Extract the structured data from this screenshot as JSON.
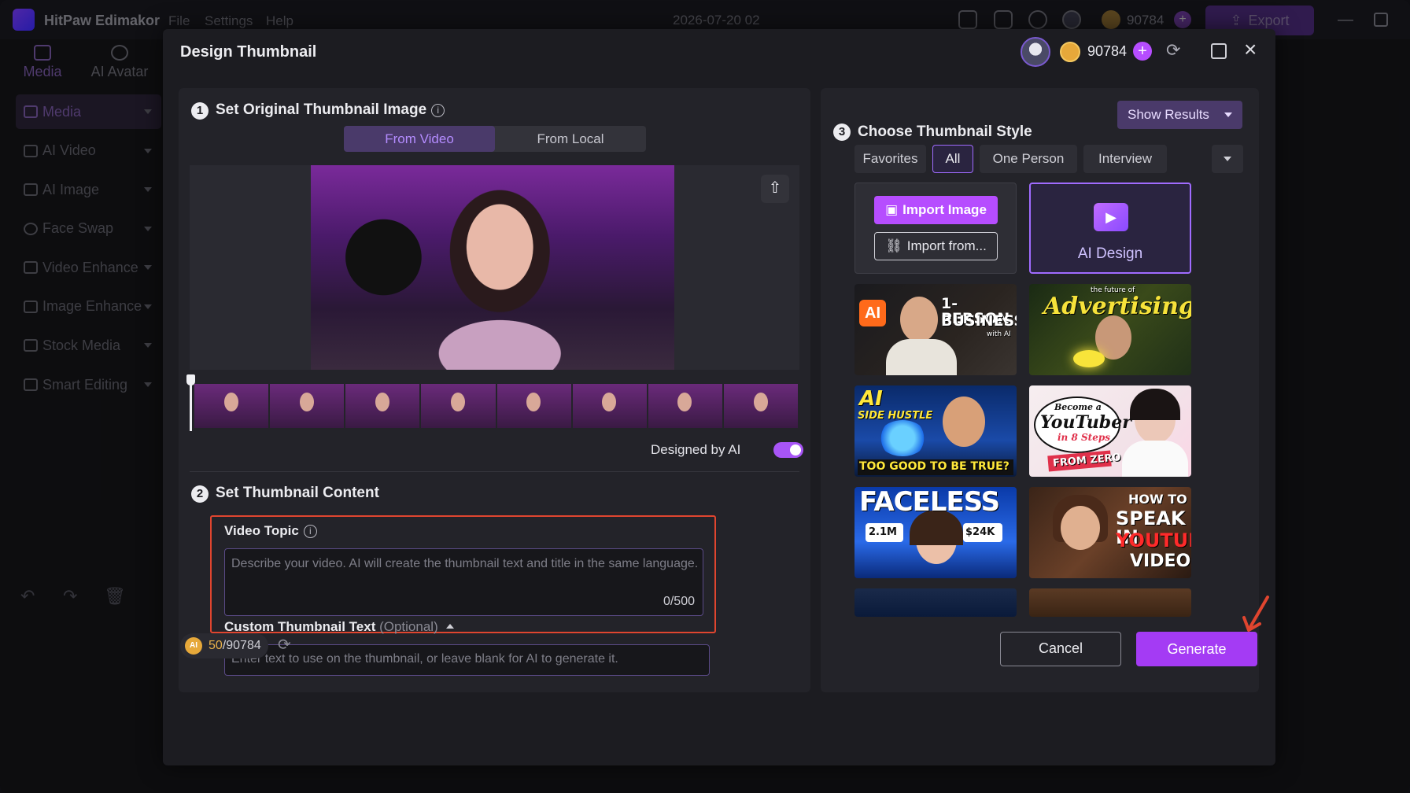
{
  "app": {
    "name": "HitPaw Edimakor",
    "menus": [
      "File",
      "Settings",
      "Help"
    ],
    "doc_title": "2026-07-20 02",
    "coins": "90784",
    "export_label": "Export"
  },
  "left_tabs": [
    {
      "label": "Media",
      "icon": "media-icon"
    },
    {
      "label": "AI Avatar",
      "icon": "avatar-icon"
    }
  ],
  "sidebar": {
    "items": [
      {
        "label": "Media"
      },
      {
        "label": "AI Video"
      },
      {
        "label": "AI Image"
      },
      {
        "label": "Face Swap"
      },
      {
        "label": "Video Enhance"
      },
      {
        "label": "Image Enhance"
      },
      {
        "label": "Stock Media"
      },
      {
        "label": "Smart Editing"
      }
    ]
  },
  "dialog": {
    "title": "Design Thumbnail",
    "coins": "90784",
    "step1": {
      "num": "1",
      "title": "Set Original Thumbnail Image",
      "tabs": [
        "From Video",
        "From Local"
      ],
      "designed_by_ai_label": "Designed by AI",
      "designed_by_ai_on": true
    },
    "step2": {
      "num": "2",
      "title": "Set Thumbnail Content",
      "video_topic_label": "Video Topic",
      "video_topic_placeholder": "Describe your video. AI will create the thumbnail text and title in the same language.",
      "video_topic_count": "0/500",
      "custom_text_label": "Custom Thumbnail Text",
      "custom_text_optional": "(Optional)",
      "custom_text_placeholder": "Enter text to use on the thumbnail, or leave blank for AI to generate it."
    },
    "step3": {
      "num": "3",
      "title": "Choose Thumbnail Style",
      "show_results": "Show Results",
      "filters": [
        "Favorites",
        "All",
        "One Person",
        "Interview"
      ],
      "import_image": "Import Image",
      "import_from": "Import from...",
      "ai_design": "AI Design",
      "thumbs": {
        "t1": {
          "badge": "AI",
          "l1": "1-PERSON",
          "l2": "BUSINESS",
          "l3": "with AI"
        },
        "t2": {
          "pre": "the future of",
          "word": "Advertising"
        },
        "t3": {
          "l1": "AI",
          "l2": "SIDE HUSTLE",
          "l3": "TOO GOOD TO BE TRUE?"
        },
        "t4": {
          "l1": "Become a",
          "l2": "YouTuber",
          "l3": "in 8 Steps",
          "l4": "FROM ZERO"
        },
        "t5": {
          "word": "FACELESS",
          "s1": "2.1M",
          "s2": "$24K"
        },
        "t6": {
          "l1": "HOW TO",
          "l2": "SPEAK IN",
          "l3": "YOUTUBE",
          "l4": "VIDEOS"
        }
      }
    },
    "footer": {
      "credits_used": "50",
      "credits_total": "/90784",
      "cancel": "Cancel",
      "generate": "Generate"
    }
  },
  "colors": {
    "accent": "#a43bf4",
    "highlight_border": "#e0452f"
  }
}
